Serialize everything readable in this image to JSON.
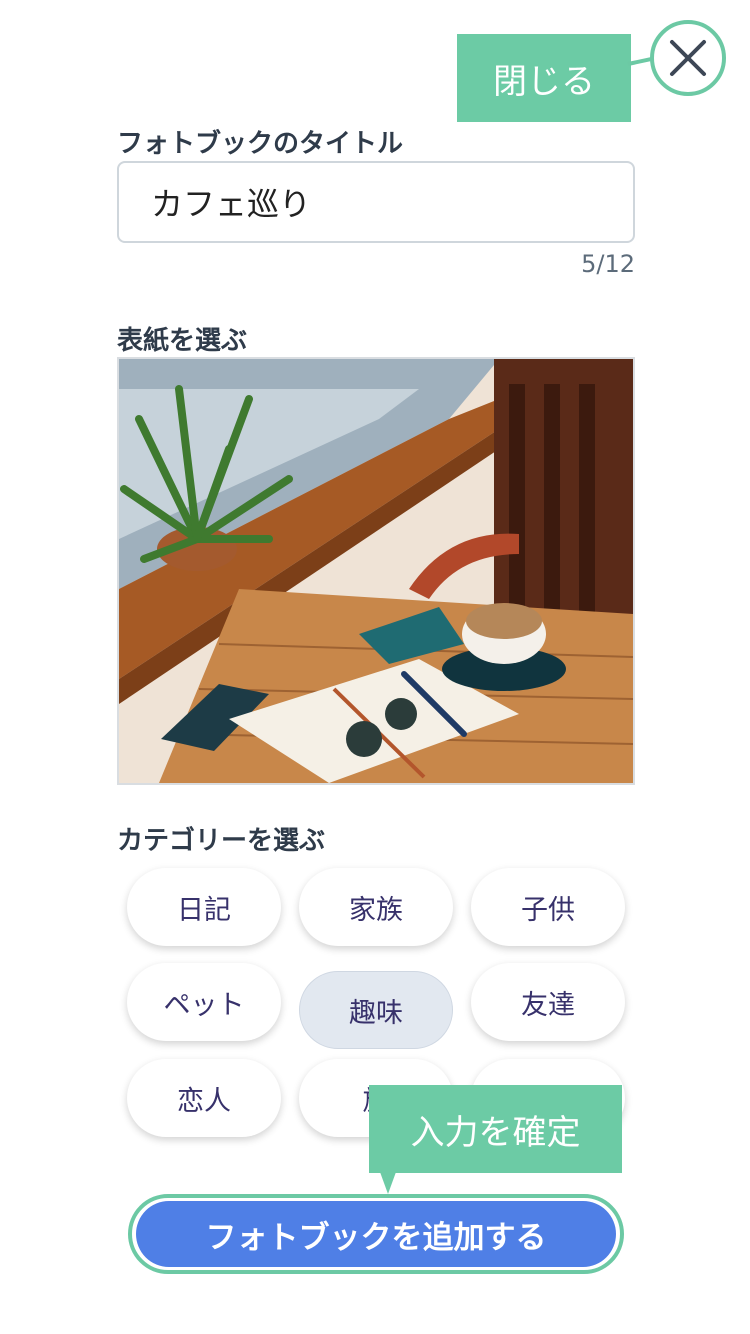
{
  "close": {
    "label": "閉じる",
    "icon": "close-icon"
  },
  "title_field": {
    "label": "フォトブックのタイトル",
    "value": "カフェ巡り",
    "counter": "5/12"
  },
  "cover": {
    "label": "表紙を選ぶ"
  },
  "category": {
    "label": "カテゴリーを選ぶ",
    "chips": [
      "日記",
      "家族",
      "子供",
      "ペット",
      "趣味",
      "友達",
      "恋人",
      "旅",
      ""
    ],
    "selected": "趣味"
  },
  "confirm_tip": "入力を確定",
  "add_button": "フォトブックを追加する",
  "colors": {
    "accent_green": "#6ccba5",
    "primary_blue": "#4f7fe6",
    "chip_selected": "#e2e8f0"
  }
}
